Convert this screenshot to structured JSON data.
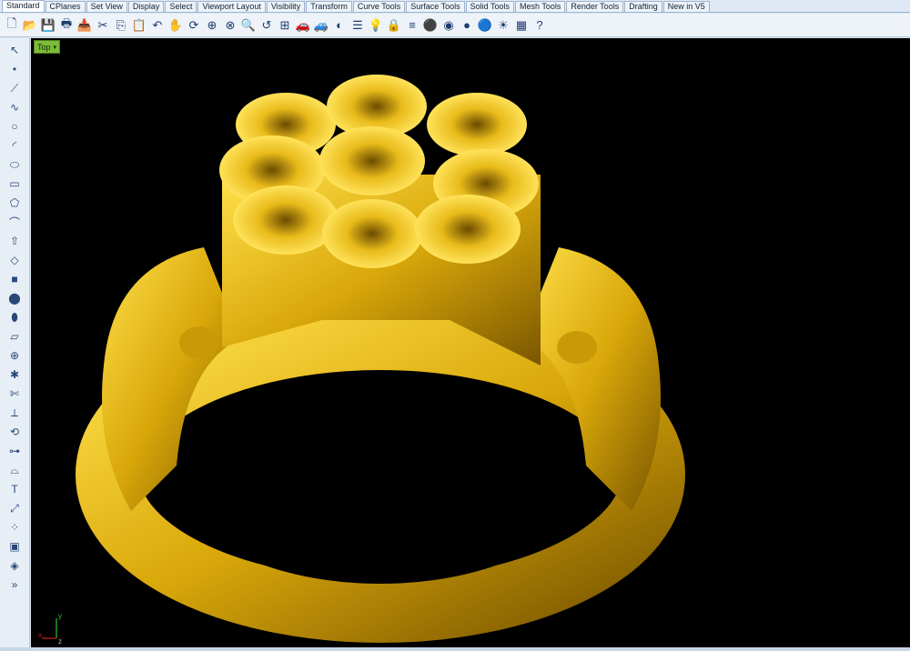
{
  "tabs": [
    "Standard",
    "CPlanes",
    "Set View",
    "Display",
    "Select",
    "Viewport Layout",
    "Visibility",
    "Transform",
    "Curve Tools",
    "Surface Tools",
    "Solid Tools",
    "Mesh Tools",
    "Render Tools",
    "Drafting",
    "New in V5"
  ],
  "toolbar_icons": [
    "new-file",
    "open-folder",
    "save",
    "print",
    "import",
    "cut",
    "copy",
    "paste",
    "undo",
    "pan-hand",
    "rotate-view",
    "zoom-window",
    "zoom-extents",
    "zoom-selected",
    "undo-view",
    "four-viewports",
    "car-object",
    "car-gray",
    "shaded-mode",
    "properties",
    "lightbulb",
    "lock",
    "layers",
    "material-ball",
    "color-wheel",
    "gray-sphere",
    "blue-sphere",
    "light",
    "render",
    "help"
  ],
  "sidebar_icons": [
    "select-arrow",
    "point",
    "polyline",
    "curve",
    "circle",
    "arc",
    "ellipse",
    "rectangle",
    "polygon",
    "curve-fillet",
    "extrude",
    "loft",
    "box",
    "sphere-group",
    "cylinder",
    "surface",
    "boolean",
    "explode",
    "trim",
    "split",
    "rebuild",
    "join",
    "fillet",
    "text",
    "transform",
    "array",
    "group",
    "analyze",
    "more"
  ],
  "viewport": {
    "label": "Top",
    "dropdown": "▾"
  },
  "axes": {
    "x": "x",
    "y": "y",
    "z": "z"
  },
  "colors": {
    "viewport_bg": "#000000",
    "gold": "#e1b40c",
    "gold_dark": "#8a6400",
    "accent_green": "#7dbb3a"
  }
}
